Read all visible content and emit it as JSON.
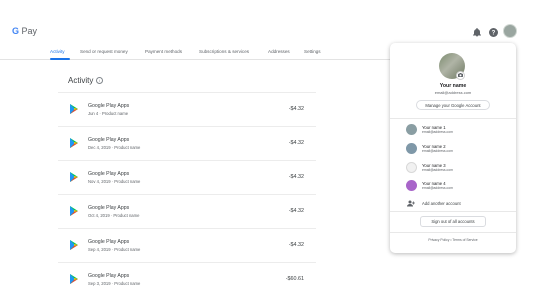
{
  "header": {
    "logo_g": "G",
    "logo_text": "Pay",
    "icons": [
      "bell-icon",
      "help-icon",
      "account-avatar"
    ]
  },
  "tabs": [
    {
      "label": "Activity",
      "active": true
    },
    {
      "label": "Send or request money",
      "active": false
    },
    {
      "label": "Payment methods",
      "active": false
    },
    {
      "label": "Subscriptions & services",
      "active": false
    },
    {
      "label": "Addresses",
      "active": false
    },
    {
      "label": "Settings",
      "active": false
    }
  ],
  "activity": {
    "title": "Activity",
    "info_icon": "i",
    "items": [
      {
        "title": "Google Play Apps",
        "subtitle": "Jun 4 · Product name",
        "amount": "-$4.32"
      },
      {
        "title": "Google Play Apps",
        "subtitle": "Dec 4, 2019 · Product name",
        "amount": "-$4.32"
      },
      {
        "title": "Google Play Apps",
        "subtitle": "Nov 4, 2019 · Product name",
        "amount": "-$4.32"
      },
      {
        "title": "Google Play Apps",
        "subtitle": "Oct 4, 2019 · Product name",
        "amount": "-$4.32"
      },
      {
        "title": "Google Play Apps",
        "subtitle": "Sep 4, 2019 · Product name",
        "amount": "-$4.32"
      },
      {
        "title": "Google Play Apps",
        "subtitle": "Sep 3, 2019 · Product name",
        "amount": "-$60.61"
      }
    ]
  },
  "account_panel": {
    "name": "Your name",
    "email": "email@address.com",
    "manage_label": "Manage your Google Account",
    "accounts": [
      {
        "name": "Your name 1",
        "email": "email@address.com",
        "color": "#8a9ea3"
      },
      {
        "name": "Your name 2",
        "email": "email@address.com",
        "color": "#7f98a8"
      },
      {
        "name": "Your name 3",
        "email": "email@address.com",
        "color": "#f1f1f1"
      },
      {
        "name": "Your name 4",
        "email": "email@address.com",
        "color": "#a865c9"
      }
    ],
    "add_account_label": "Add another account",
    "signout_label": "Sign out of all accounts",
    "footer": "Privacy Policy  •  Terms of Service"
  },
  "colors": {
    "accent": "#1a73e8",
    "play_green": "#00c853",
    "play_blue": "#2196f3",
    "play_yellow": "#ffc107",
    "play_red": "#f44336"
  }
}
